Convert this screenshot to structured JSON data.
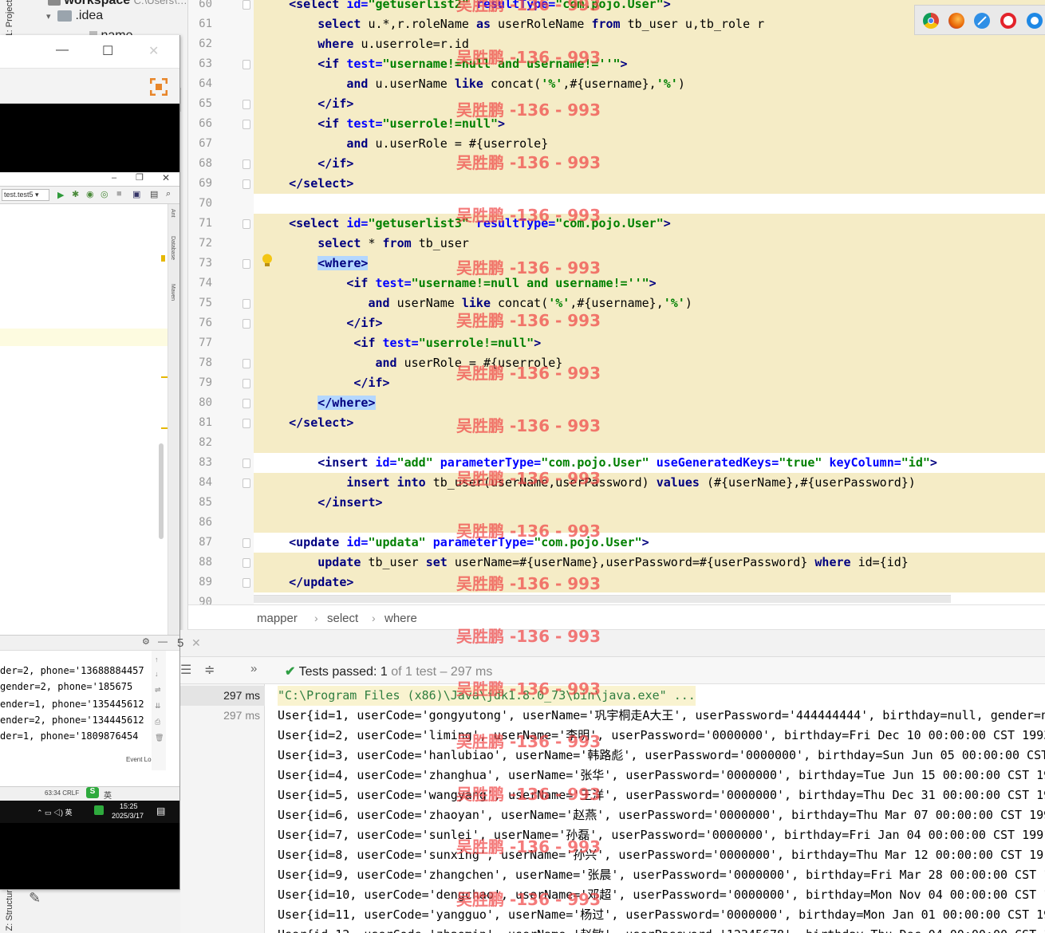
{
  "project_tree": {
    "vtab_label": "1: Project",
    "root_label": "workspace",
    "root_path": "C:\\Users\\…",
    "idea_folder": ".idea",
    "child_item": "name"
  },
  "structure_tab_label": "Z: Structure",
  "inner_window": {
    "combo_label": "test.test5",
    "side_tabs": [
      "Ant",
      "Database",
      "Maven"
    ],
    "console_lines": [
      "der=2, phone='13688884457",
      " gender=2, phone='185675",
      "ender=1, phone='135445612",
      "ender=2, phone='134445612",
      "der=1, phone='1809876454"
    ],
    "status_text": "63:34  CRLF",
    "event_log": "Event Log",
    "taskbar_time": "15:25",
    "taskbar_date": "2025/3/17",
    "taskbar_lang": "英"
  },
  "editor": {
    "lines": [
      {
        "n": "60",
        "tokens": [
          {
            "t": "    "
          },
          {
            "c": "tg",
            "t": "<select "
          },
          {
            "c": "at",
            "t": "id="
          },
          {
            "c": "sv",
            "t": "\"getuserlist2\" "
          },
          {
            "c": "at",
            "t": "resultType="
          },
          {
            "c": "sv",
            "t": "\"com.pojo.User\""
          },
          {
            "c": "tg",
            "t": ">"
          }
        ]
      },
      {
        "n": "61",
        "tokens": [
          {
            "t": "        "
          },
          {
            "c": "kw",
            "t": "select "
          },
          {
            "t": "u.*,r.roleName "
          },
          {
            "c": "kw",
            "t": "as "
          },
          {
            "t": "userRoleName "
          },
          {
            "c": "kw",
            "t": "from "
          },
          {
            "t": "tb_user u,tb_role r"
          }
        ]
      },
      {
        "n": "62",
        "tokens": [
          {
            "t": "        "
          },
          {
            "c": "kw",
            "t": "where "
          },
          {
            "t": "u.userrole=r.id"
          }
        ]
      },
      {
        "n": "63",
        "tokens": [
          {
            "t": "        "
          },
          {
            "c": "tg",
            "t": "<if "
          },
          {
            "c": "at",
            "t": "test="
          },
          {
            "c": "sv",
            "t": "\"username!=null and username!=''\""
          },
          {
            "c": "tg",
            "t": ">"
          }
        ]
      },
      {
        "n": "64",
        "tokens": [
          {
            "t": "            "
          },
          {
            "c": "kw",
            "t": "and "
          },
          {
            "t": "u.userName "
          },
          {
            "c": "kw",
            "t": "like "
          },
          {
            "t": "concat("
          },
          {
            "c": "sq",
            "t": "'%'"
          },
          {
            "t": ",#{username},"
          },
          {
            "c": "sq",
            "t": "'%'"
          },
          {
            "t": ")"
          }
        ]
      },
      {
        "n": "65",
        "tokens": [
          {
            "t": "        "
          },
          {
            "c": "tg",
            "t": "</if>"
          }
        ]
      },
      {
        "n": "66",
        "tokens": [
          {
            "t": "        "
          },
          {
            "c": "tg",
            "t": "<if "
          },
          {
            "c": "at",
            "t": "test="
          },
          {
            "c": "sv",
            "t": "\"userrole!=null\""
          },
          {
            "c": "tg",
            "t": ">"
          }
        ]
      },
      {
        "n": "67",
        "tokens": [
          {
            "t": "            "
          },
          {
            "c": "kw",
            "t": "and "
          },
          {
            "t": "u.userRole = #{userrole}"
          }
        ]
      },
      {
        "n": "68",
        "tokens": [
          {
            "t": "        "
          },
          {
            "c": "tg",
            "t": "</if>"
          }
        ]
      },
      {
        "n": "69",
        "tokens": [
          {
            "t": "    "
          },
          {
            "c": "tg",
            "t": "</select>"
          }
        ]
      },
      {
        "n": "70",
        "tokens": []
      },
      {
        "n": "71",
        "tokens": [
          {
            "t": "    "
          },
          {
            "c": "tg",
            "t": "<select "
          },
          {
            "c": "at",
            "t": "id="
          },
          {
            "c": "sv",
            "t": "\"getuserlist3\" "
          },
          {
            "c": "at",
            "t": "resultType="
          },
          {
            "c": "sv",
            "t": "\"com.pojo.User\""
          },
          {
            "c": "tg",
            "t": ">"
          }
        ]
      },
      {
        "n": "72",
        "tokens": [
          {
            "t": "        "
          },
          {
            "c": "kw",
            "t": "select "
          },
          {
            "t": "* "
          },
          {
            "c": "kw",
            "t": "from "
          },
          {
            "t": "tb_user"
          }
        ]
      },
      {
        "n": "73",
        "tokens": [
          {
            "t": "        "
          },
          {
            "c": "tg tagsel",
            "t": "<where>"
          }
        ]
      },
      {
        "n": "74",
        "tokens": [
          {
            "t": "            "
          },
          {
            "c": "tg",
            "t": "<if "
          },
          {
            "c": "at",
            "t": "test="
          },
          {
            "c": "sv",
            "t": "\"username!=null and username!=''\""
          },
          {
            "c": "tg",
            "t": ">"
          }
        ]
      },
      {
        "n": "75",
        "tokens": [
          {
            "t": "               "
          },
          {
            "c": "kw",
            "t": "and "
          },
          {
            "t": "userName "
          },
          {
            "c": "kw",
            "t": "like "
          },
          {
            "t": "concat("
          },
          {
            "c": "sq",
            "t": "'%'"
          },
          {
            "t": ",#{username},"
          },
          {
            "c": "sq",
            "t": "'%'"
          },
          {
            "t": ")"
          }
        ]
      },
      {
        "n": "76",
        "tokens": [
          {
            "t": "            "
          },
          {
            "c": "tg",
            "t": "</if>"
          }
        ]
      },
      {
        "n": "77",
        "tokens": [
          {
            "t": "             "
          },
          {
            "c": "tg",
            "t": "<if "
          },
          {
            "c": "at",
            "t": "test="
          },
          {
            "c": "sv",
            "t": "\"userrole!=null\""
          },
          {
            "c": "tg",
            "t": ">"
          }
        ]
      },
      {
        "n": "78",
        "tokens": [
          {
            "t": "                "
          },
          {
            "c": "kw",
            "t": "and "
          },
          {
            "t": "userRole = #{userrole}"
          }
        ]
      },
      {
        "n": "79",
        "tokens": [
          {
            "t": "             "
          },
          {
            "c": "tg",
            "t": "</if>"
          }
        ]
      },
      {
        "n": "80",
        "tokens": [
          {
            "t": "        "
          },
          {
            "c": "tg tagsel",
            "t": "</where>"
          }
        ]
      },
      {
        "n": "81",
        "tokens": [
          {
            "t": "    "
          },
          {
            "c": "tg",
            "t": "</select>"
          }
        ]
      },
      {
        "n": "82",
        "tokens": []
      },
      {
        "n": "83",
        "tokens": [
          {
            "t": "        "
          },
          {
            "c": "tg",
            "t": "<insert "
          },
          {
            "c": "at",
            "t": "id="
          },
          {
            "c": "sv",
            "t": "\"add\" "
          },
          {
            "c": "at",
            "t": "parameterType="
          },
          {
            "c": "sv",
            "t": "\"com.pojo.User\" "
          },
          {
            "c": "at",
            "t": "useGeneratedKeys="
          },
          {
            "c": "sv",
            "t": "\"true\" "
          },
          {
            "c": "at",
            "t": "keyColumn="
          },
          {
            "c": "sv",
            "t": "\"id\""
          },
          {
            "c": "tg",
            "t": ">"
          }
        ]
      },
      {
        "n": "84",
        "tokens": [
          {
            "t": "            "
          },
          {
            "c": "kw",
            "t": "insert into "
          },
          {
            "t": "tb_user(userName,userPassword) "
          },
          {
            "c": "kw",
            "t": "values "
          },
          {
            "t": "(#{userName},#{userPassword})"
          }
        ]
      },
      {
        "n": "85",
        "tokens": [
          {
            "t": "        "
          },
          {
            "c": "tg",
            "t": "</insert>"
          }
        ]
      },
      {
        "n": "86",
        "tokens": []
      },
      {
        "n": "87",
        "tokens": [
          {
            "t": "    "
          },
          {
            "c": "tg",
            "t": "<update "
          },
          {
            "c": "at",
            "t": "id="
          },
          {
            "c": "sv",
            "t": "\"updata\" "
          },
          {
            "c": "at",
            "t": "parameterType="
          },
          {
            "c": "sv",
            "t": "\"com.pojo.User\""
          },
          {
            "c": "tg",
            "t": ">"
          }
        ]
      },
      {
        "n": "88",
        "tokens": [
          {
            "t": "        "
          },
          {
            "c": "kw",
            "t": "update "
          },
          {
            "t": "tb_user "
          },
          {
            "c": "kw",
            "t": "set "
          },
          {
            "t": "userName=#{userName},userPassword=#{userPassword} "
          },
          {
            "c": "kw",
            "t": "where "
          },
          {
            "t": "id={id}"
          }
        ]
      },
      {
        "n": "89",
        "tokens": [
          {
            "t": "    "
          },
          {
            "c": "tg",
            "t": "</update>"
          }
        ]
      },
      {
        "n": "90",
        "tokens": []
      }
    ]
  },
  "breadcrumb": [
    "mapper",
    "select",
    "where"
  ],
  "run": {
    "tab_suffix": "5",
    "tests_passed_label": "Tests passed:",
    "tests_passed_count": "1",
    "tests_passed_detail": "of 1 test – 297 ms",
    "tree_times": [
      "297 ms",
      "297 ms"
    ],
    "command_line": "\"C:\\Program Files (x86)\\Java\\jdk1.8.0_73\\bin\\java.exe\" ...",
    "output": [
      "User{id=1, userCode='gongyutong', userName='巩宇桐走A大王', userPassword='444444444', birthday=null, gender=n",
      "User{id=2, userCode='liming', userName='李明', userPassword='0000000', birthday=Fri Dec 10 00:00:00 CST 1993",
      "User{id=3, userCode='hanlubiao', userName='韩路彪', userPassword='0000000', birthday=Sun Jun 05 00:00:00 CST",
      "User{id=4, userCode='zhanghua', userName='张华', userPassword='0000000', birthday=Tue Jun 15 00:00:00 CST 19",
      "User{id=5, userCode='wangyang', userName='王洋', userPassword='0000000', birthday=Thu Dec 31 00:00:00 CST 19",
      "User{id=6, userCode='zhaoyan', userName='赵燕', userPassword='0000000', birthday=Thu Mar 07 00:00:00 CST 199",
      "User{id=7, userCode='sunlei', userName='孙磊', userPassword='0000000', birthday=Fri Jan 04 00:00:00 CST 1991",
      "User{id=8, userCode='sunxing', userName='孙兴', userPassword='0000000', birthday=Thu Mar 12 00:00:00 CST 19",
      "User{id=9, userCode='zhangchen', userName='张晨', userPassword='0000000', birthday=Fri Mar 28 00:00:00 CST 1",
      "User{id=10, userCode='dengchao', userName='邓超', userPassword='0000000', birthday=Mon Nov 04 00:00:00 CST 1",
      "User{id=11, userCode='yangguo', userName='杨过', userPassword='0000000', birthday=Mon Jan 01 00:00:00 CST 19",
      "User{id=12, userCode='zhaomin', userName='赵敏', userPassword='12345678', birthday=Thu Dec 04 00:00:00 CST 1"
    ]
  },
  "watermark": "吴胜鹏 -136 - 993",
  "browsers": [
    "chrome-icon",
    "firefox-icon",
    "safari-icon",
    "opera-icon",
    "edge-icon"
  ],
  "colors": {
    "scope_band": "#f5ecc6",
    "tag": "#000080",
    "attr": "#0000ff",
    "string": "#008000",
    "watermark": "#f04646",
    "pass_green": "#2f9e44"
  }
}
